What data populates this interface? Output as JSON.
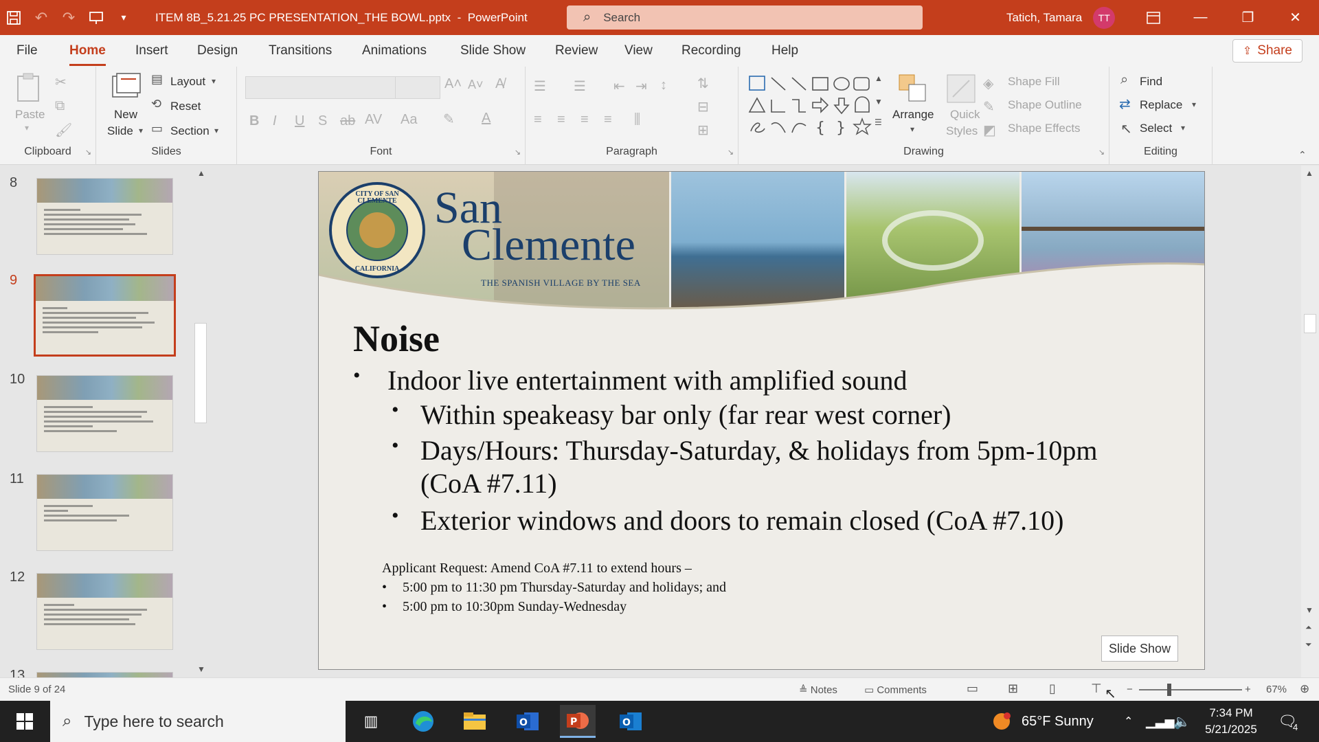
{
  "titlebar": {
    "filename": "ITEM 8B_5.21.25 PC PRESENTATION_THE BOWL.pptx",
    "separator": "-",
    "app": "PowerPoint",
    "search_placeholder": "Search",
    "user_name": "Tatich, Tamara",
    "user_initials": "TT"
  },
  "menu": {
    "tabs": [
      "File",
      "Home",
      "Insert",
      "Design",
      "Transitions",
      "Animations",
      "Slide Show",
      "Review",
      "View",
      "Recording",
      "Help"
    ],
    "active": "Home",
    "share": "Share"
  },
  "ribbon": {
    "clipboard": {
      "paste": "Paste",
      "label": "Clipboard"
    },
    "slides": {
      "new_slide": "New",
      "new_slide2": "Slide",
      "layout": "Layout",
      "reset": "Reset",
      "section": "Section",
      "label": "Slides"
    },
    "font": {
      "label": "Font"
    },
    "paragraph": {
      "label": "Paragraph"
    },
    "drawing": {
      "arrange": "Arrange",
      "quick_styles": "Quick",
      "quick_styles2": "Styles",
      "shape_fill": "Shape Fill",
      "shape_outline": "Shape Outline",
      "shape_effects": "Shape Effects",
      "label": "Drawing"
    },
    "editing": {
      "find": "Find",
      "replace": "Replace",
      "select": "Select",
      "label": "Editing"
    }
  },
  "thumbnails": [
    {
      "num": "8",
      "selected": false
    },
    {
      "num": "9",
      "selected": true
    },
    {
      "num": "10",
      "selected": false
    },
    {
      "num": "11",
      "selected": false
    },
    {
      "num": "12",
      "selected": false
    },
    {
      "num": "13",
      "selected": false
    }
  ],
  "slide": {
    "logo_line1": "CITY OF SAN CLEMENTE",
    "logo_line2": "CALIFORNIA",
    "brand_top": "San",
    "brand_bottom": "Clemente",
    "brand_tagline": "THE SPANISH VILLAGE BY THE SEA",
    "title": "Noise",
    "bullet1": "Indoor live entertainment with amplified sound",
    "sub1": "Within speakeasy bar only (far rear west corner)",
    "sub2a": "Days/Hours: Thursday-Saturday, & holidays from 5pm-10pm",
    "sub2b": "(CoA #7.11)",
    "sub3": "Exterior windows and doors to remain closed (CoA #7.10)",
    "request_heading": "Applicant Request: Amend CoA #7.11 to extend hours –",
    "request1": "5:00 pm to 11:30 pm Thursday-Saturday and holidays; and",
    "request2": "5:00 pm to 10:30pm Sunday-Wednesday"
  },
  "tooltip": "Slide Show",
  "status": {
    "slide_counter": "Slide 9 of 24",
    "notes": "Notes",
    "comments": "Comments",
    "zoom": "67%"
  },
  "taskbar": {
    "search_placeholder": "Type here to search",
    "weather": "65°F  Sunny",
    "time": "7:34 PM",
    "date": "5/21/2025",
    "notif_count": "4"
  },
  "colors": {
    "accent": "#c43e1c",
    "taskbar": "#212121"
  }
}
